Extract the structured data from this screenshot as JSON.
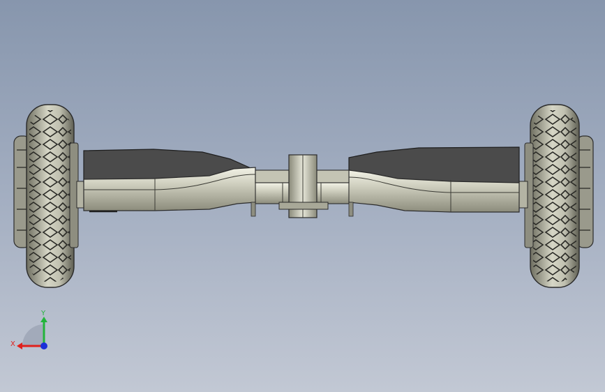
{
  "viewport": {
    "background_top": "#8796ad",
    "background_bottom": "#c2c8d4"
  },
  "model": {
    "body_color": "#c9c9b8",
    "deck_color": "#4a4a4a",
    "tire_color": "#c2c2b2",
    "edge_color": "#2a2a2a"
  },
  "triad": {
    "x_label": "X",
    "y_label": "Y",
    "x_color": "#e0201c",
    "y_color": "#22b43a",
    "z_color": "#1c30d8"
  }
}
